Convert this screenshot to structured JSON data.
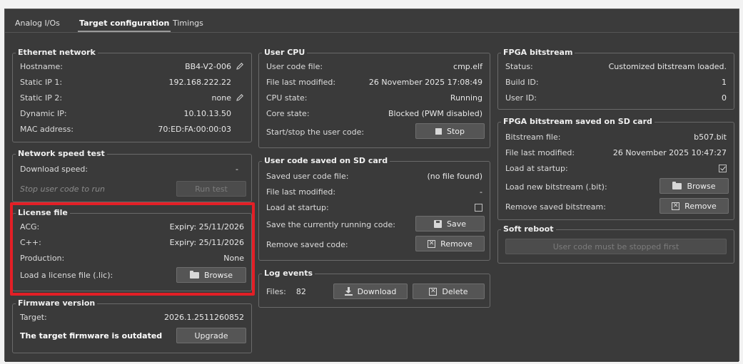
{
  "tabs": [
    "Analog I/Os",
    "Target configuration",
    "Timings"
  ],
  "active_tab": "Target configuration",
  "ethernet": {
    "title": "Ethernet network",
    "rows": [
      {
        "label": "Hostname:",
        "value": "BB4-V2-006"
      },
      {
        "label": "Static IP 1:",
        "value": "192.168.222.22"
      },
      {
        "label": "Static IP 2:",
        "value": "none"
      },
      {
        "label": "Dynamic IP:",
        "value": "10.10.13.50"
      },
      {
        "label": "MAC address:",
        "value": "70:ED:FA:00:00:03"
      }
    ]
  },
  "speed_test": {
    "title": "Network speed test",
    "download_label": "Download speed:",
    "download_value": "-",
    "hint": "Stop user code to run",
    "button": "Run test"
  },
  "license": {
    "title": "License file",
    "rows": [
      {
        "label": "ACG:",
        "value": "Expiry: 25/11/2026"
      },
      {
        "label": "C++:",
        "value": "Expiry: 25/11/2026"
      },
      {
        "label": "Production:",
        "value": "None"
      }
    ],
    "load_label": "Load a license file (.lic):",
    "button": "Browse"
  },
  "firmware": {
    "title": "Firmware version",
    "target_label": "Target:",
    "target_value": "2026.1.2511260852",
    "outdated_label": "The target firmware is outdated",
    "button": "Upgrade"
  },
  "user_cpu": {
    "title": "User CPU",
    "rows": [
      {
        "label": "User code file:",
        "value": "cmp.elf"
      },
      {
        "label": "File last modified:",
        "value": "26 November 2025 17:08:49"
      },
      {
        "label": "CPU state:",
        "value": "Running"
      },
      {
        "label": "Core state:",
        "value": "Blocked (PWM disabled)"
      }
    ],
    "start_stop_label": "Start/stop the user code:",
    "button": "Stop"
  },
  "sd_code": {
    "title": "User code saved on SD card",
    "saved_label": "Saved user code file:",
    "saved_value": "(no file found)",
    "modified_label": "File last modified:",
    "modified_value": "-",
    "load_label": "Load at startup:",
    "load_checked": false,
    "save_label": "Save the currently running code:",
    "save_button": "Save",
    "remove_label": "Remove saved code:",
    "remove_button": "Remove"
  },
  "log_events": {
    "title": "Log events",
    "files_label": "Files:",
    "files_value": "82",
    "download_button": "Download",
    "delete_button": "Delete"
  },
  "fpga": {
    "title": "FPGA bitstream",
    "rows": [
      {
        "label": "Status:",
        "value": "Customized bitstream loaded."
      },
      {
        "label": "Build ID:",
        "value": "1"
      },
      {
        "label": "User ID:",
        "value": "0"
      }
    ]
  },
  "fpga_sd": {
    "title": "FPGA bitstream saved on SD card",
    "file_label": "Bitstream file:",
    "file_value": "b507.bit",
    "modified_label": "File last modified:",
    "modified_value": "26 November 2025 10:47:27",
    "load_label": "Load at startup:",
    "load_checked": true,
    "new_label": "Load new bitstream (.bit):",
    "browse_button": "Browse",
    "remove_label": "Remove saved bitstream:",
    "remove_button": "Remove"
  },
  "soft_reboot": {
    "title": "Soft reboot",
    "button": "User code must be stopped first"
  },
  "colors": {
    "background": "#3a3a3a",
    "highlight": "#e31f26"
  }
}
